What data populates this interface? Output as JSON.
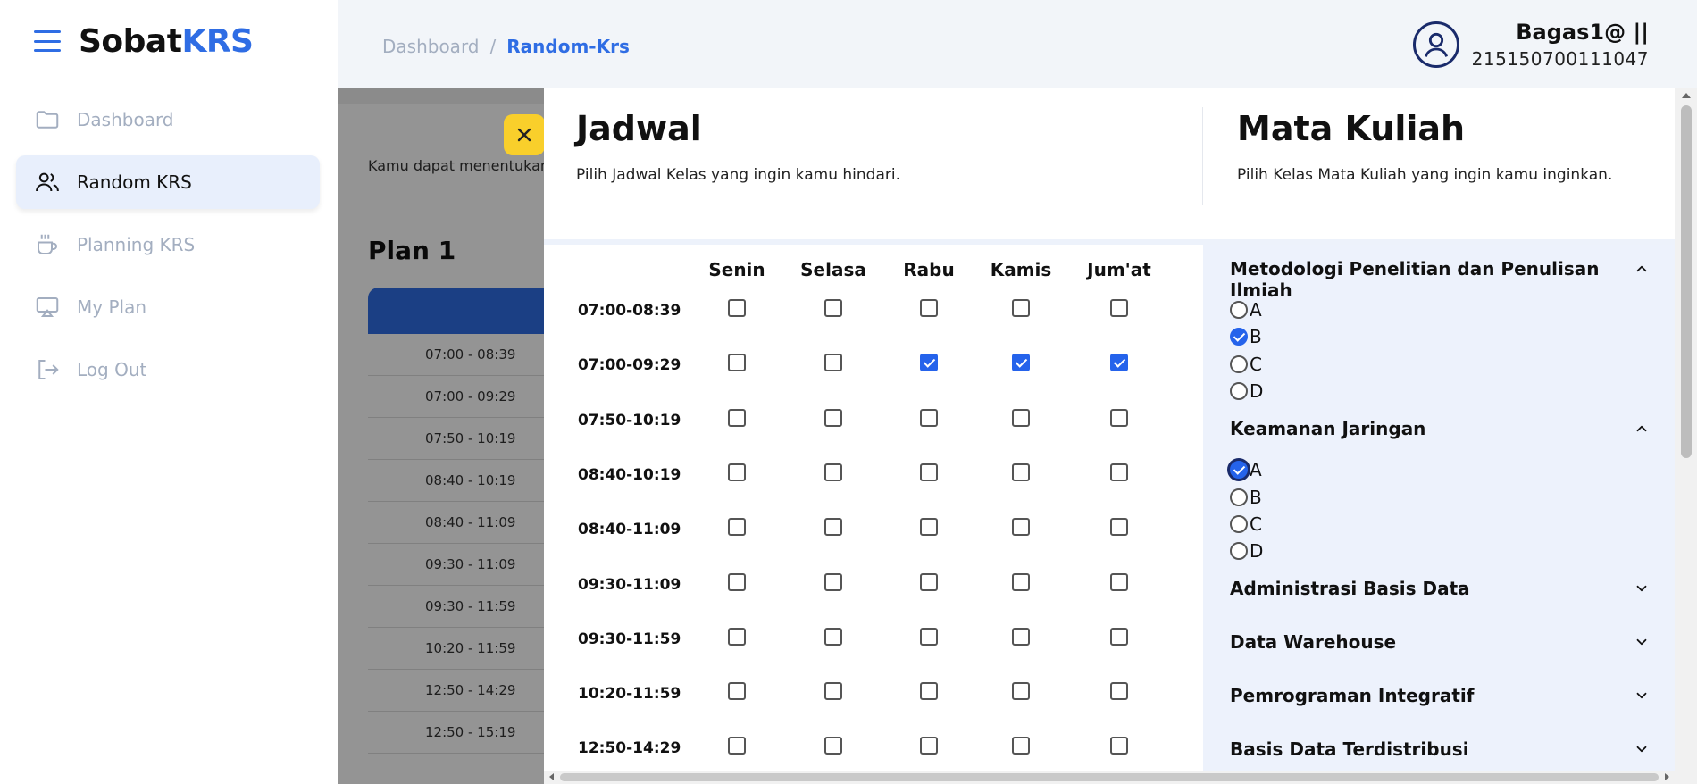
{
  "brand": {
    "name_main": "Sobat",
    "name_accent": "KRS"
  },
  "sidebar": {
    "items": [
      {
        "label": "Dashboard",
        "icon": "folder-icon",
        "active": false
      },
      {
        "label": "Random KRS",
        "icon": "users-icon",
        "active": true
      },
      {
        "label": "Planning KRS",
        "icon": "coffee-cup-icon",
        "active": false
      },
      {
        "label": "My Plan",
        "icon": "monitor-icon",
        "active": false
      },
      {
        "label": "Log Out",
        "icon": "logout-icon",
        "active": false
      }
    ]
  },
  "breadcrumb": {
    "home": "Dashboard",
    "separator": "/",
    "current": "Random-Krs"
  },
  "user": {
    "name": "Bagas1@ ||",
    "nim": "215150700111047"
  },
  "modal": {
    "jadwal": {
      "title": "Jadwal",
      "subtitle": "Pilih Jadwal Kelas yang ingin kamu hindari.",
      "days": [
        "Senin",
        "Selasa",
        "Rabu",
        "Kamis",
        "Jum'at"
      ],
      "rows": [
        {
          "time": "07:00-08:39",
          "checked": [
            false,
            false,
            false,
            false,
            false
          ]
        },
        {
          "time": "07:00-09:29",
          "checked": [
            false,
            false,
            true,
            true,
            true
          ]
        },
        {
          "time": "07:50-10:19",
          "checked": [
            false,
            false,
            false,
            false,
            false
          ]
        },
        {
          "time": "08:40-10:19",
          "checked": [
            false,
            false,
            false,
            false,
            false
          ]
        },
        {
          "time": "08:40-11:09",
          "checked": [
            false,
            false,
            false,
            false,
            false
          ]
        },
        {
          "time": "09:30-11:09",
          "checked": [
            false,
            false,
            false,
            false,
            false
          ]
        },
        {
          "time": "09:30-11:59",
          "checked": [
            false,
            false,
            false,
            false,
            false
          ]
        },
        {
          "time": "10:20-11:59",
          "checked": [
            false,
            false,
            false,
            false,
            false
          ]
        },
        {
          "time": "12:50-14:29",
          "checked": [
            false,
            false,
            false,
            false,
            false
          ]
        }
      ]
    },
    "mata_kuliah": {
      "title": "Mata Kuliah",
      "subtitle": "Pilih Kelas Mata Kuliah yang ingin kamu inginkan.",
      "courses": [
        {
          "name": "Metodologi Penelitian dan Penulisan Ilmiah",
          "expanded": true,
          "options": [
            "A",
            "B",
            "C",
            "D"
          ],
          "selected": "B"
        },
        {
          "name": "Keamanan Jaringan",
          "expanded": true,
          "options": [
            "A",
            "B",
            "C",
            "D"
          ],
          "selected": "A"
        },
        {
          "name": "Administrasi Basis Data",
          "expanded": false
        },
        {
          "name": "Data Warehouse",
          "expanded": false
        },
        {
          "name": "Pemrograman Integratif",
          "expanded": false
        },
        {
          "name": "Basis Data Terdistribusi",
          "expanded": false
        }
      ]
    }
  },
  "background_page": {
    "plan_title": "Plan 1",
    "rows": [
      "07:00 - 08:39",
      "07:00 - 09:29",
      "07:50 - 10:19",
      "08:40 - 10:19",
      "08:40 - 11:09",
      "09:30 - 11:09",
      "09:30 - 11:59",
      "10:20 - 11:59",
      "12:50 - 14:29",
      "12:50 - 15:19"
    ]
  },
  "colors": {
    "accent": "#2f6de4",
    "close_button": "#f9cf2b",
    "checked": "#2563eb",
    "course_panel": "#edf2fc"
  }
}
